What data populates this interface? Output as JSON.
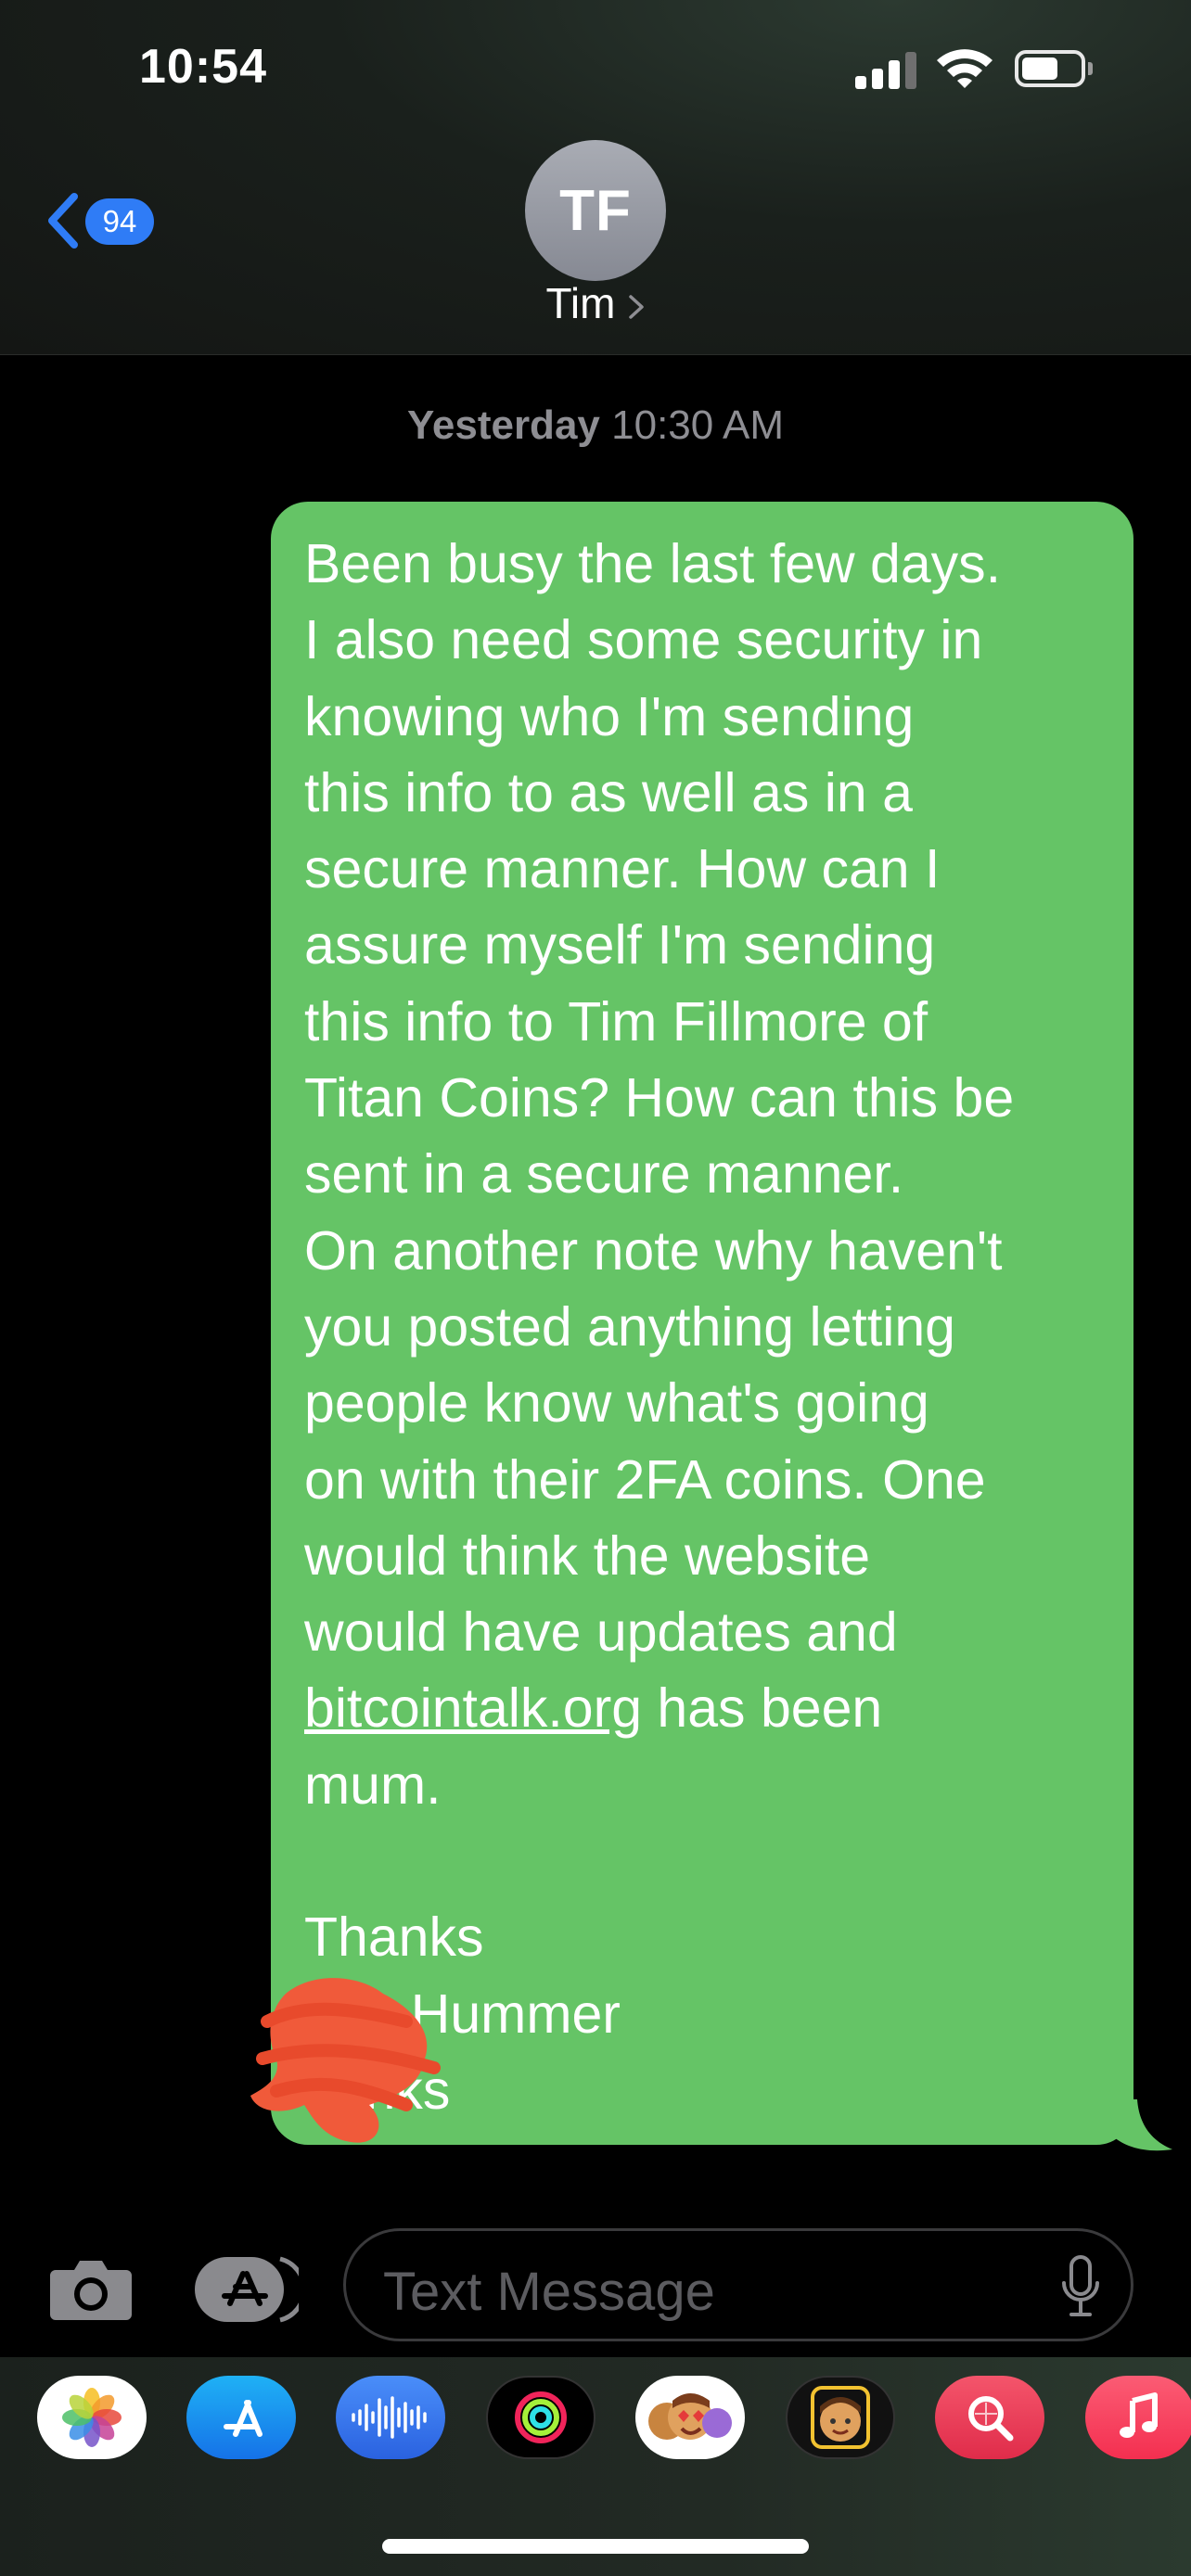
{
  "status_bar": {
    "time": "10:54"
  },
  "nav": {
    "back_count": "94",
    "avatar_initials": "TF",
    "contact_name": "Tim"
  },
  "conversation": {
    "timestamp_day": "Yesterday",
    "timestamp_time": "10:30 AM",
    "message_before_link": "Been busy the last few days.\nI also need some security in\nknowing who I'm sending\nthis info to as well as in a\nsecure manner. How can I\nassure myself I'm sending\nthis info to Tim Fillmore of\nTitan Coins? How can this be\nsent in a secure manner.\nOn another note why haven't\nyou posted anything letting\npeople know what's going\non with their 2FA coins. One\nwould think the website\nwould have updates and\n",
    "message_link": "bitcointalk.org",
    "message_after_link": " has been\nmum.\n\nThanks\n       Hummer\n  anks",
    "bubble_color": "#65c466"
  },
  "composer": {
    "placeholder": "Text Message"
  },
  "app_drawer": {
    "apps": [
      {
        "name": "photos-icon"
      },
      {
        "name": "app-store-icon"
      },
      {
        "name": "audio-message-icon"
      },
      {
        "name": "fitness-icon"
      },
      {
        "name": "memoji-stickers-icon"
      },
      {
        "name": "memoji-icon"
      },
      {
        "name": "image-search-icon"
      },
      {
        "name": "music-icon"
      }
    ]
  },
  "colors": {
    "accent_blue": "#2f7cf6",
    "sent_green": "#65c466",
    "redaction": "#f05a3a"
  }
}
